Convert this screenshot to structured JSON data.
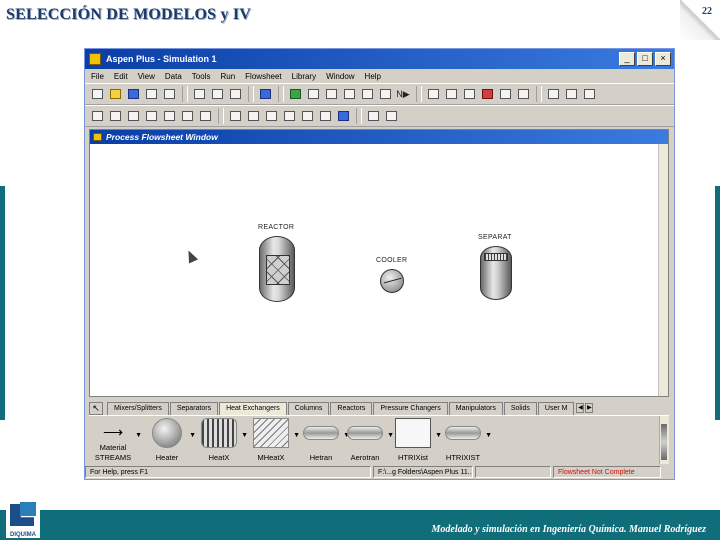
{
  "slide": {
    "title": "SELECCIÓN DE MODELOS y IV",
    "number": "22",
    "footer": "Modelado y simulación en Ingeniería Química. Manuel Rodríguez",
    "logo_text": "DIQUIMA",
    "accent_color": "#0f6e7a"
  },
  "window": {
    "title": "Aspen Plus - Simulation 1",
    "controls": [
      "_",
      "□",
      "×"
    ]
  },
  "menu": [
    "File",
    "Edit",
    "View",
    "Data",
    "Tools",
    "Run",
    "Flowsheet",
    "Library",
    "Window",
    "Help"
  ],
  "toolbar": {
    "next_label": "N▶"
  },
  "flowsheet": {
    "title": "Process Flowsheet Window",
    "blocks": [
      {
        "name": "REACTOR",
        "icon": "reactor-icon"
      },
      {
        "name": "COOLER",
        "icon": "heater-icon"
      },
      {
        "name": "SEPARAT",
        "icon": "flash-separator-icon"
      }
    ]
  },
  "palette": {
    "tabs": [
      "Mixers/Splitters",
      "Separators",
      "Heat Exchangers",
      "Columns",
      "Reactors",
      "Pressure Changers",
      "Manipulators",
      "Solids",
      "User M"
    ],
    "active_tab": "Heat Exchangers",
    "stream_label": "Material",
    "stream_group": "STREAMS",
    "models": [
      "Heater",
      "HeatX",
      "MHeatX",
      "Hetran",
      "Aerotran",
      "HTRIXist",
      "HTRIXIST"
    ]
  },
  "status": {
    "help": "For Help, press F1",
    "folder": "F:\\...g Folders\\Aspen Plus 11...",
    "flowsheet_status": "Flowsheet Not Complete"
  }
}
